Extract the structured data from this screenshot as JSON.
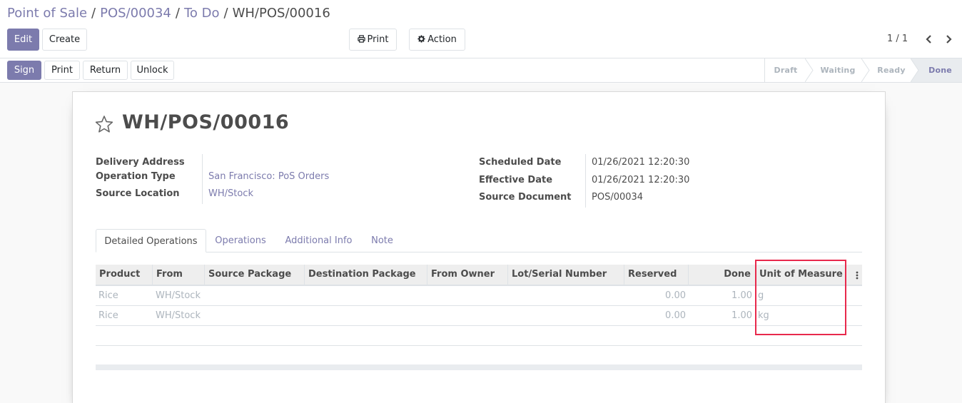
{
  "breadcrumb": {
    "root": "Point of Sale",
    "level2": "POS/00034",
    "level3": "To Do",
    "current": "WH/POS/00016",
    "separator": "/"
  },
  "toolbar": {
    "edit_label": "Edit",
    "create_label": "Create",
    "print_label": "Print",
    "action_label": "Action"
  },
  "pager": {
    "value": "1 / 1"
  },
  "statusbar": {
    "buttons": [
      "Sign",
      "Print",
      "Return",
      "Unlock"
    ],
    "stages": [
      "Draft",
      "Waiting",
      "Ready",
      "Done"
    ],
    "active_stage": "Done"
  },
  "record": {
    "title": "WH/POS/00016",
    "left_fields": [
      {
        "label": "Delivery Address",
        "value": ""
      },
      {
        "label": "Operation Type",
        "value": "San Francisco: PoS Orders"
      },
      {
        "label": "Source Location",
        "value": "WH/Stock"
      }
    ],
    "right_fields": [
      {
        "label": "Scheduled Date",
        "value": "01/26/2021 12:20:30"
      },
      {
        "label": "Effective Date",
        "value": "01/26/2021 12:20:30"
      },
      {
        "label": "Source Document",
        "value": "POS/00034"
      }
    ]
  },
  "tabs": [
    "Detailed Operations",
    "Operations",
    "Additional Info",
    "Note"
  ],
  "table": {
    "columns": [
      "Product",
      "From",
      "Source Package",
      "Destination Package",
      "From Owner",
      "Lot/Serial Number",
      "Reserved",
      "Done",
      "Unit of Measure"
    ],
    "rows": [
      {
        "product": "Rice",
        "from": "WH/Stock",
        "source_package": "",
        "destination_package": "",
        "from_owner": "",
        "lot": "",
        "reserved": "0.00",
        "done": "1.00",
        "uom": "g"
      },
      {
        "product": "Rice",
        "from": "WH/Stock",
        "source_package": "",
        "destination_package": "",
        "from_owner": "",
        "lot": "",
        "reserved": "0.00",
        "done": "1.00",
        "uom": "kg"
      }
    ]
  },
  "colors": {
    "brand": "#7c7bad",
    "highlight": "#e8294c"
  }
}
